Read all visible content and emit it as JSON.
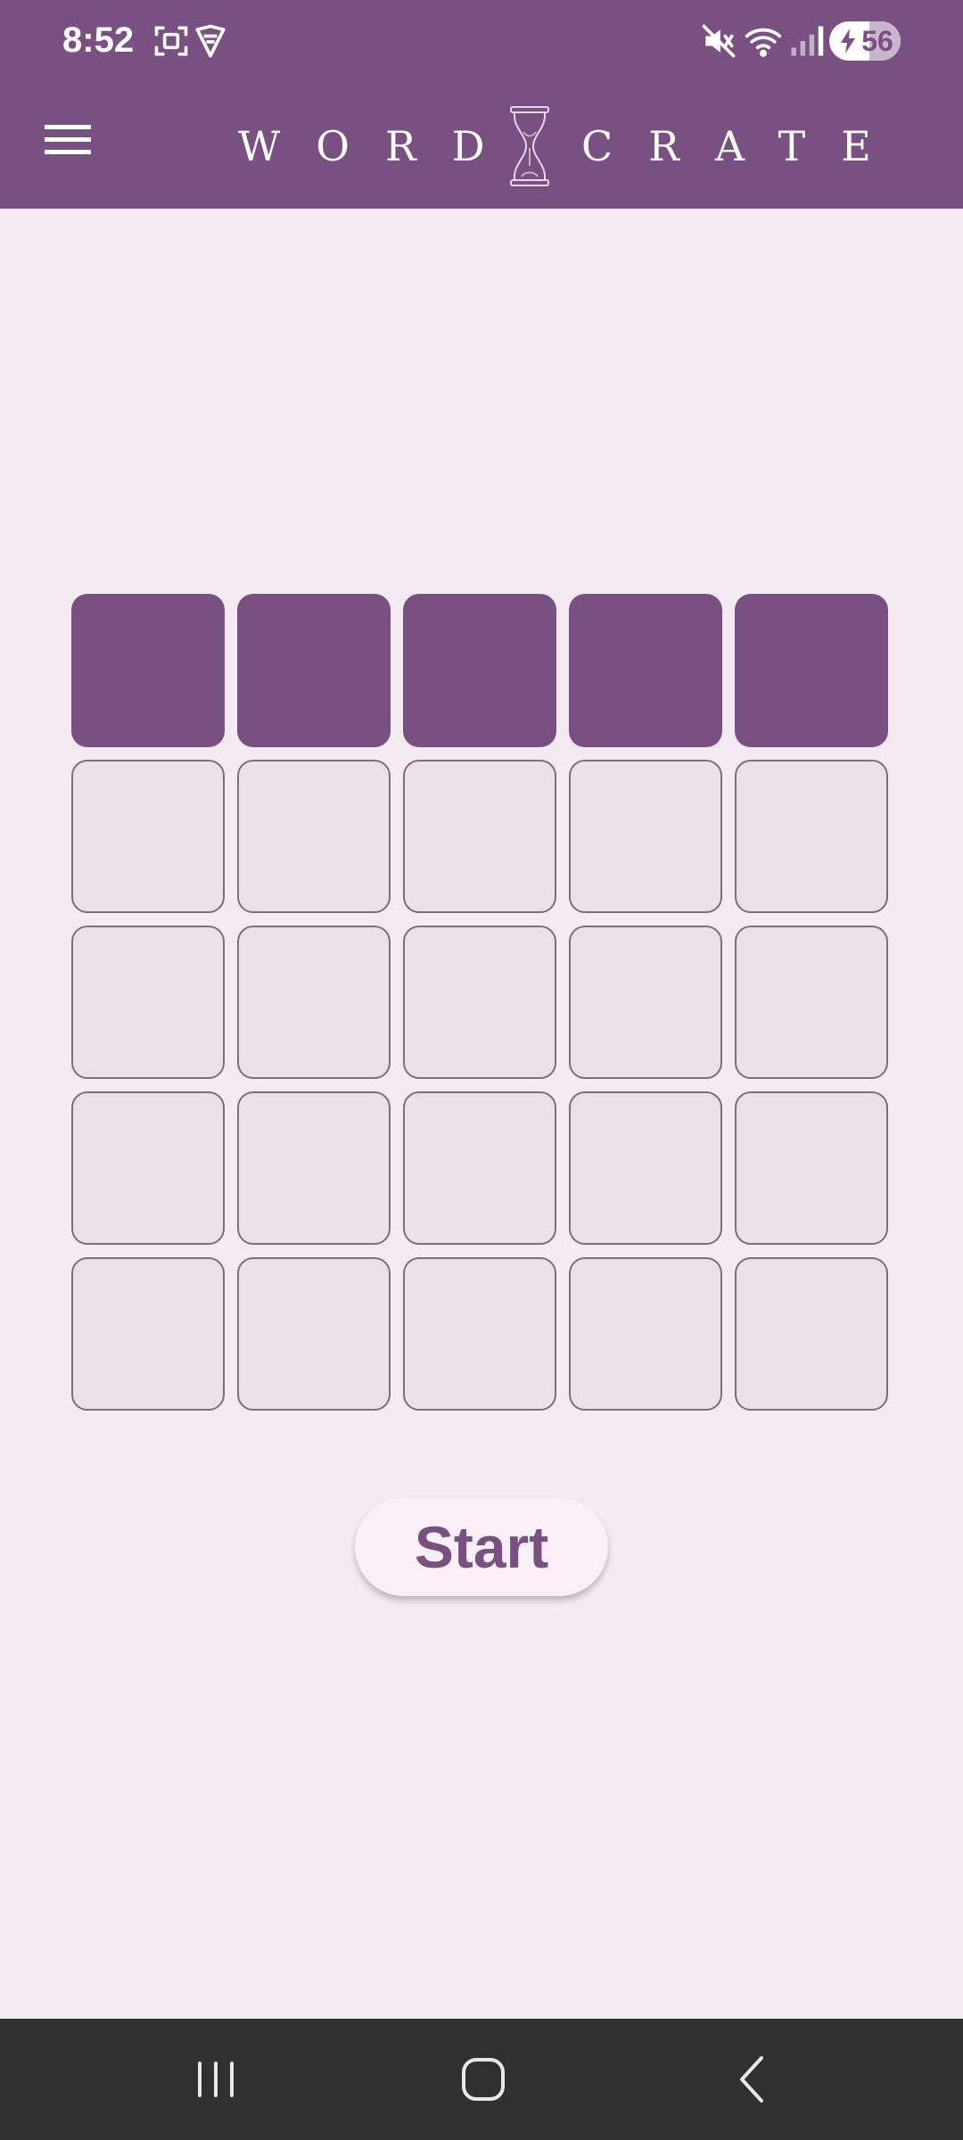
{
  "status_bar": {
    "time": "8:52",
    "battery_level": "56",
    "battery_fraction": 0.56,
    "icons": [
      "screenshot-icon",
      "vpn-shield-icon",
      "mute-icon",
      "wifi-icon",
      "signal-icon",
      "battery-icon"
    ]
  },
  "header": {
    "logo_left": "WORD",
    "logo_right": "CRATE",
    "logo_emblem": "hourglass-icon",
    "menu_icon": "hamburger-menu-icon",
    "background_color": "#795082"
  },
  "board": {
    "columns": 5,
    "rows": 5,
    "filled_rows": 1,
    "tiles": [
      [
        "",
        "",
        "",
        "",
        ""
      ],
      [
        "",
        "",
        "",
        "",
        ""
      ],
      [
        "",
        "",
        "",
        "",
        ""
      ],
      [
        "",
        "",
        "",
        "",
        ""
      ],
      [
        "",
        "",
        "",
        "",
        ""
      ]
    ],
    "filled_color": "#795082",
    "empty_color": "#eae0e8"
  },
  "actions": {
    "start_label": "Start"
  },
  "nav_bar": {
    "items": [
      "recent-apps-icon",
      "home-icon",
      "back-icon"
    ]
  }
}
